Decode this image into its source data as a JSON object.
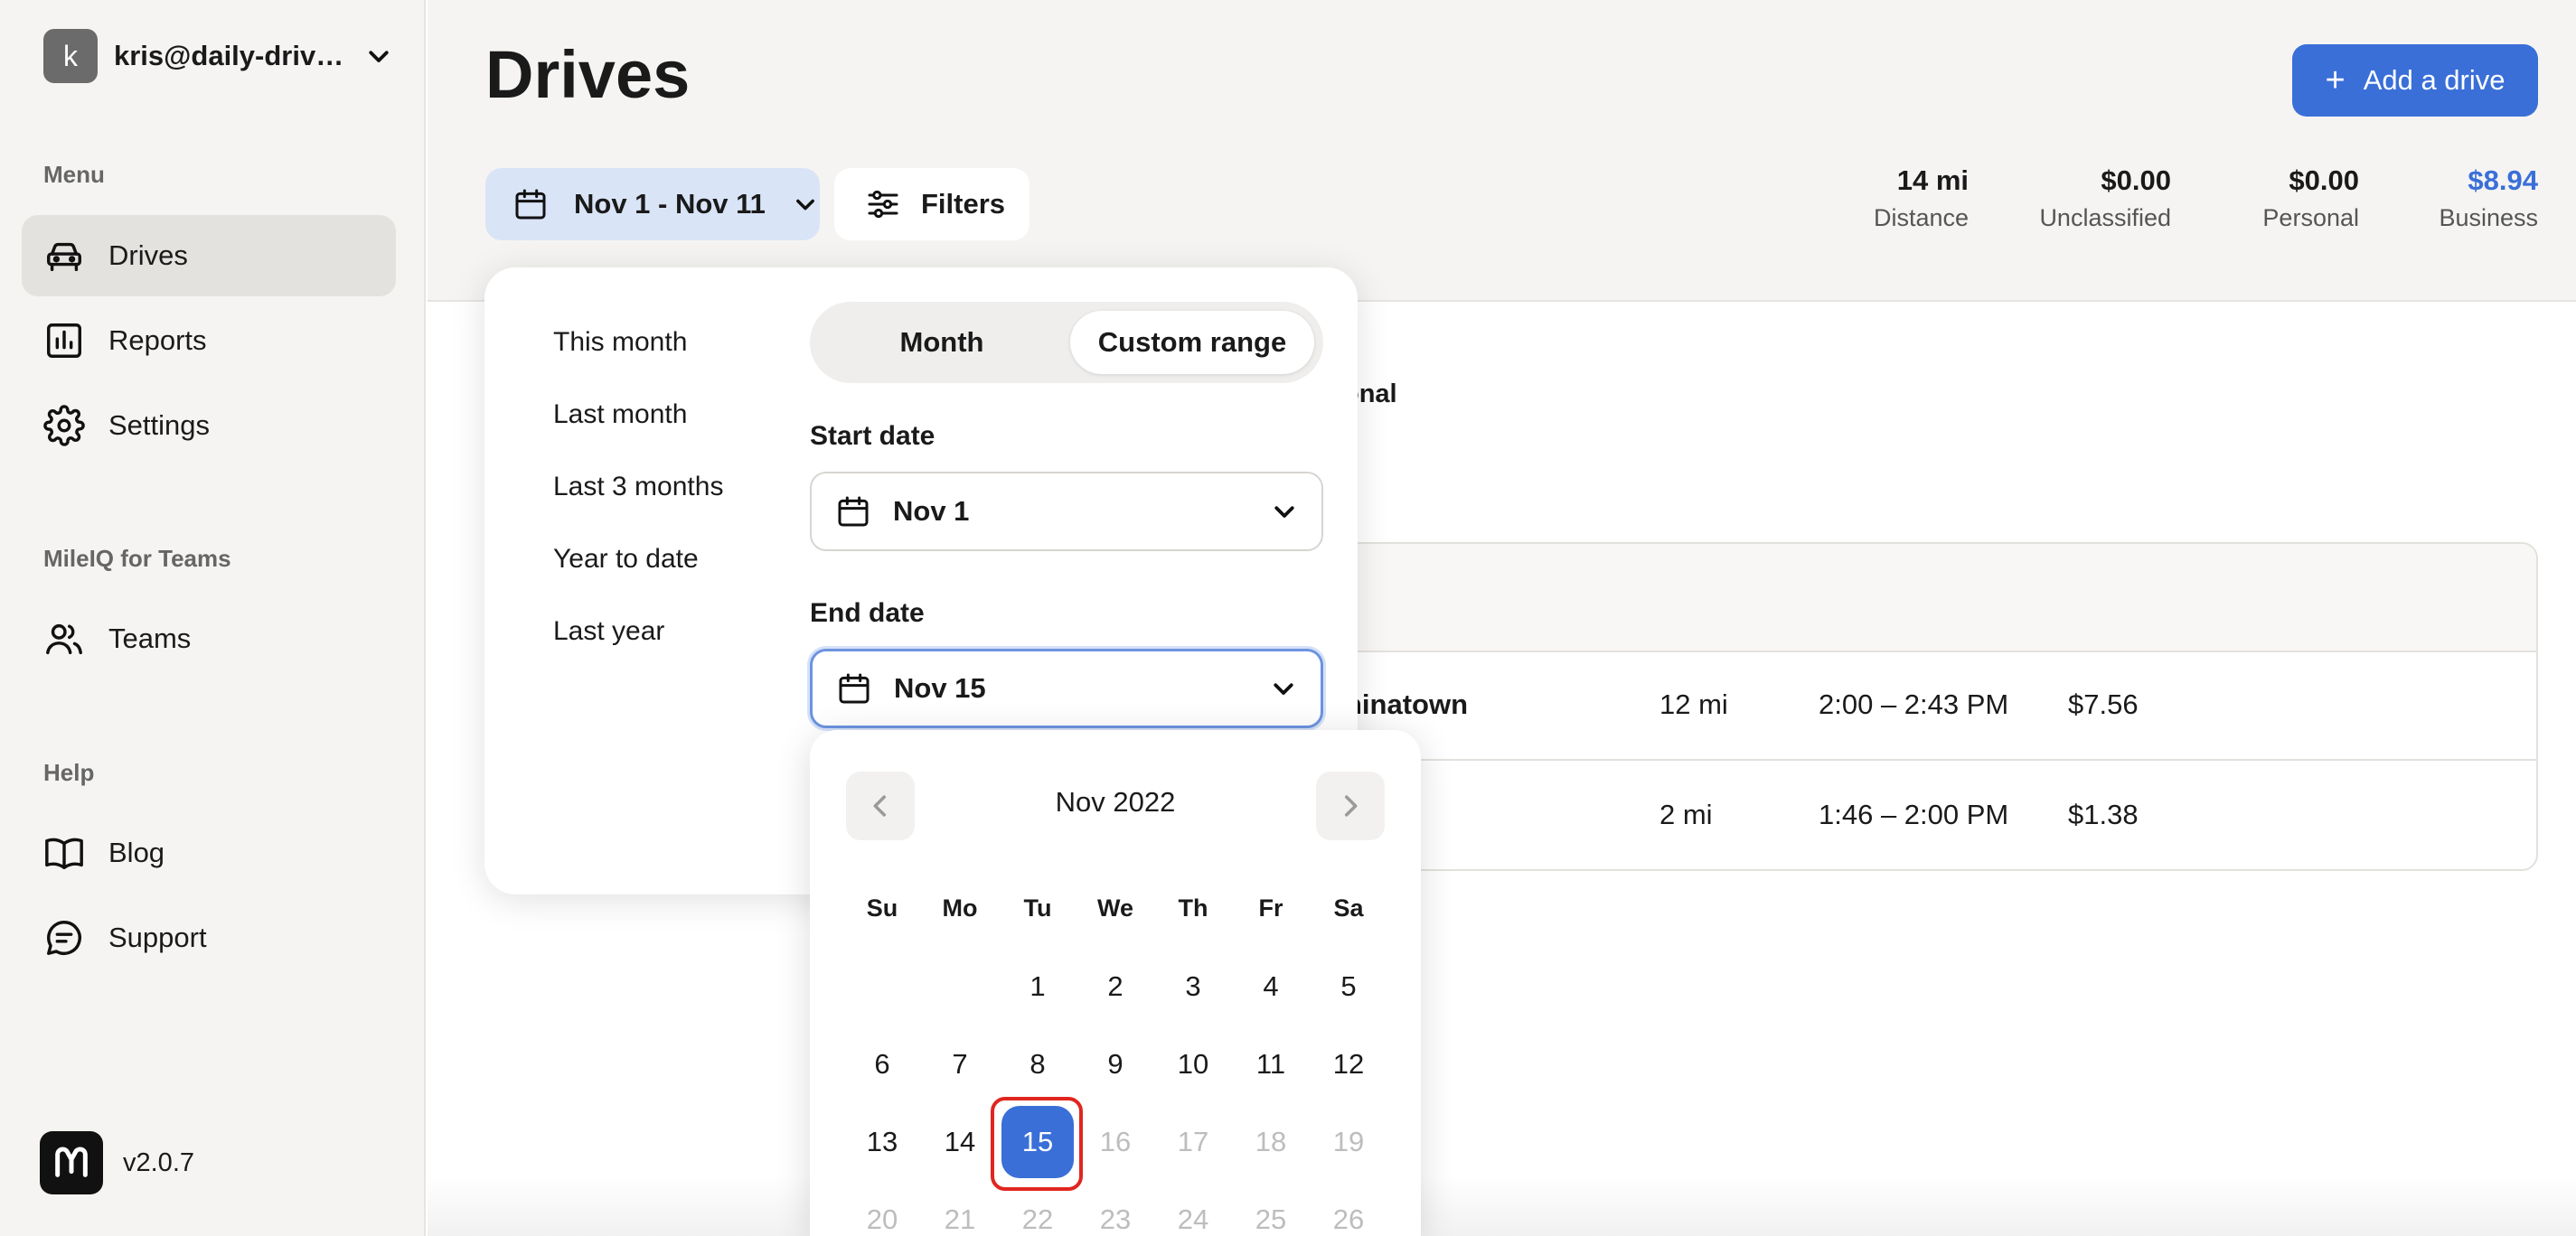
{
  "account": {
    "initial": "k",
    "email": "kris@daily-drive..."
  },
  "sidebar": {
    "menu_label": "Menu",
    "items": [
      {
        "label": "Drives"
      },
      {
        "label": "Reports"
      },
      {
        "label": "Settings"
      }
    ],
    "teams_label": "MileIQ for Teams",
    "teams_item": {
      "label": "Teams"
    },
    "help_label": "Help",
    "help_items": [
      {
        "label": "Blog"
      },
      {
        "label": "Support"
      }
    ],
    "version": "v2.0.7"
  },
  "header": {
    "title": "Drives",
    "add_label": "Add a drive",
    "date_range": "Nov 1 - Nov 11",
    "filters_label": "Filters",
    "stats": [
      {
        "value": "14 mi",
        "label": "Distance"
      },
      {
        "value": "$0.00",
        "label": "Unclassified"
      },
      {
        "value": "$0.00",
        "label": "Personal"
      },
      {
        "value": "$8.94",
        "label": "Business"
      }
    ]
  },
  "background": {
    "tab_partial": "onal",
    "rows": [
      {
        "place": "hinatown",
        "distance": "12 mi",
        "time": "2:00 – 2:43 PM",
        "amount": "$7.56"
      },
      {
        "place": "",
        "distance": "2 mi",
        "time": "1:46 – 2:00 PM",
        "amount": "$1.38"
      }
    ]
  },
  "popover": {
    "presets": [
      "This month",
      "Last month",
      "Last 3 months",
      "Year to date",
      "Last year"
    ],
    "toggle": {
      "month": "Month",
      "custom": "Custom range",
      "active": "custom"
    },
    "start_label": "Start date",
    "start_value": "Nov 1",
    "end_label": "End date",
    "end_value": "Nov 15"
  },
  "calendar": {
    "title": "Nov 2022",
    "weekdays": [
      "Su",
      "Mo",
      "Tu",
      "We",
      "Th",
      "Fr",
      "Sa"
    ],
    "weeks": [
      [
        "",
        "",
        "1",
        "2",
        "3",
        "4",
        "5"
      ],
      [
        "6",
        "7",
        "8",
        "9",
        "10",
        "11",
        "12"
      ],
      [
        "13",
        "14",
        "15",
        "16",
        "17",
        "18",
        "19"
      ],
      [
        "20",
        "21",
        "22",
        "23",
        "24",
        "25",
        "26"
      ]
    ],
    "selected": "15",
    "last_enabled": 15
  },
  "colors": {
    "accent": "#3a6fd8",
    "highlight_ring": "#e0261f"
  }
}
